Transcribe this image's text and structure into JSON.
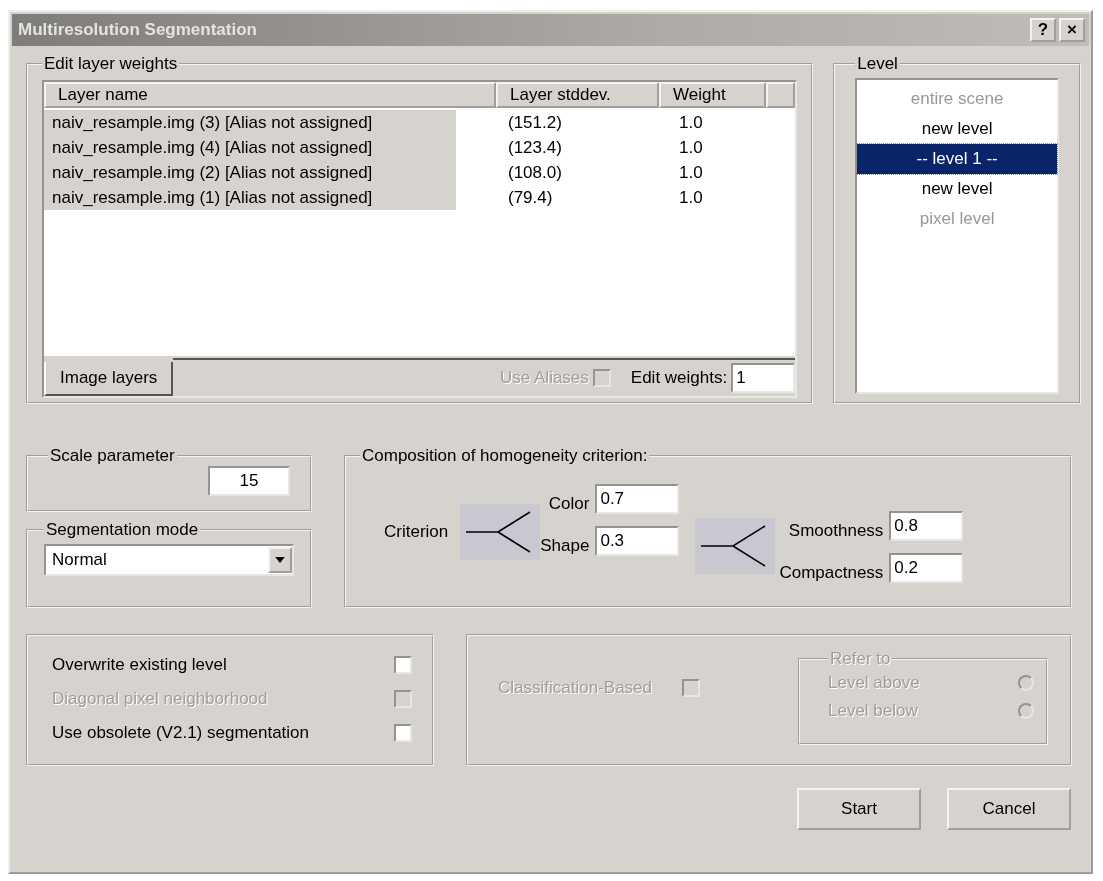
{
  "window": {
    "title": "Multiresolution Segmentation",
    "title_buttons": [
      "?",
      "×"
    ]
  },
  "layer_weights": {
    "title": "Edit layer weights",
    "columns": [
      "Layer name",
      "Layer stddev.",
      "Weight"
    ],
    "rows": [
      {
        "name": "naiv_resample.img (3) [Alias not assigned]",
        "stddev": "(151.2)",
        "weight": "1.0",
        "selected": true
      },
      {
        "name": "naiv_resample.img (4) [Alias not assigned]",
        "stddev": "(123.4)",
        "weight": "1.0",
        "selected": true
      },
      {
        "name": "naiv_resample.img (2) [Alias not assigned]",
        "stddev": "(108.0)",
        "weight": "1.0",
        "selected": true
      },
      {
        "name": "naiv_resample.img (1) [Alias not assigned]",
        "stddev": "(79.4)",
        "weight": "1.0",
        "selected": true
      }
    ],
    "tabs": [
      {
        "label": "Image layers",
        "selected": true
      }
    ],
    "use_aliases": {
      "label": "Use Aliases",
      "checked": false,
      "disabled": true
    },
    "edit_weights": {
      "label": "Edit weights:",
      "value": "1"
    }
  },
  "level": {
    "title": "Level",
    "items": [
      {
        "label": "entire scene",
        "selected": false,
        "disabled": true
      },
      {
        "label": "new level",
        "selected": false,
        "disabled": false
      },
      {
        "label": "-- level 1 --",
        "selected": true,
        "disabled": false
      },
      {
        "label": "new level",
        "selected": false,
        "disabled": false
      },
      {
        "label": "pixel level",
        "selected": false,
        "disabled": true
      }
    ]
  },
  "scale_parameter": {
    "title": "Scale parameter",
    "value": "15"
  },
  "segmentation_mode": {
    "title": "Segmentation mode",
    "value": "Normal"
  },
  "composition": {
    "title": "Composition of homogeneity criterion:",
    "criterion": "Criterion",
    "color": {
      "label": "Color",
      "value": "0.7"
    },
    "shape": {
      "label": "Shape",
      "value": "0.3"
    },
    "smoothness": {
      "label": "Smoothness",
      "value": "0.8"
    },
    "compactness": {
      "label": "Compactness",
      "value": "0.2"
    }
  },
  "options": [
    {
      "label": "Overwrite existing level",
      "checked": false,
      "disabled": false
    },
    {
      "label": "Diagonal pixel neighborhood",
      "checked": false,
      "disabled": true
    },
    {
      "label": "Use obsolete (V2.1) segmentation",
      "checked": false,
      "disabled": false
    }
  ],
  "classification": {
    "label": "Classification-Based",
    "checked": false,
    "disabled": true,
    "refer_to": {
      "title": "Refer to",
      "disabled": true,
      "options": [
        {
          "label": "Level above",
          "selected": false,
          "disabled": true
        },
        {
          "label": "Level below",
          "selected": false,
          "disabled": true
        }
      ]
    }
  },
  "buttons": [
    "Start",
    "Cancel"
  ]
}
